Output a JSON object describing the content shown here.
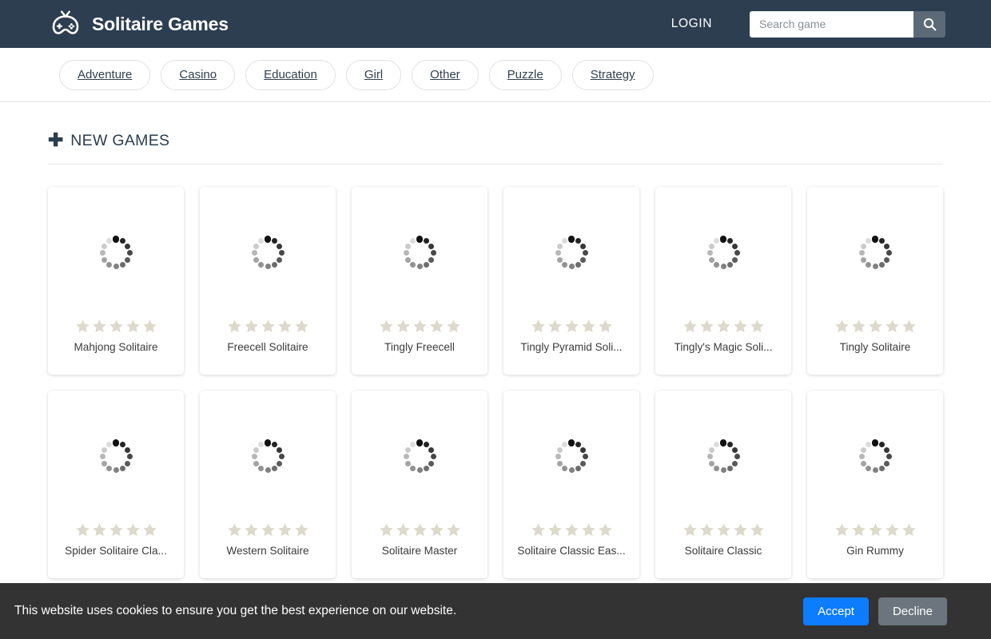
{
  "header": {
    "brand_name": "Solitaire Games",
    "brand_icon": "gamepad-icon",
    "login_label": "LOGIN",
    "search": {
      "placeholder": "Search game",
      "value": "",
      "button_icon": "search-icon"
    },
    "background_color": "#2c3e50"
  },
  "categories": [
    {
      "label": "Adventure"
    },
    {
      "label": "Casino"
    },
    {
      "label": "Education"
    },
    {
      "label": "Girl"
    },
    {
      "label": "Other"
    },
    {
      "label": "Puzzle"
    },
    {
      "label": "Strategy"
    }
  ],
  "section": {
    "plus_icon": "plus-icon",
    "title": "NEW GAMES"
  },
  "games": [
    {
      "title": "Mahjong Solitaire",
      "rating": 0,
      "max_rating": 5,
      "thumb_state": "loading"
    },
    {
      "title": "Freecell Solitaire",
      "rating": 0,
      "max_rating": 5,
      "thumb_state": "loading"
    },
    {
      "title": "Tingly Freecell",
      "rating": 0,
      "max_rating": 5,
      "thumb_state": "loading"
    },
    {
      "title": "Tingly Pyramid Soli...",
      "rating": 0,
      "max_rating": 5,
      "thumb_state": "loading"
    },
    {
      "title": "Tingly's Magic Soli...",
      "rating": 0,
      "max_rating": 5,
      "thumb_state": "loading"
    },
    {
      "title": "Tingly Solitaire",
      "rating": 0,
      "max_rating": 5,
      "thumb_state": "loading"
    },
    {
      "title": "Spider Solitaire Cla...",
      "rating": 0,
      "max_rating": 5,
      "thumb_state": "loading"
    },
    {
      "title": "Western Solitaire",
      "rating": 0,
      "max_rating": 5,
      "thumb_state": "loading"
    },
    {
      "title": "Solitaire Master",
      "rating": 0,
      "max_rating": 5,
      "thumb_state": "loading"
    },
    {
      "title": "Solitaire Classic Eas...",
      "rating": 0,
      "max_rating": 5,
      "thumb_state": "loading"
    },
    {
      "title": "Solitaire Classic",
      "rating": 0,
      "max_rating": 5,
      "thumb_state": "loading"
    },
    {
      "title": "Gin Rummy",
      "rating": 0,
      "max_rating": 5,
      "thumb_state": "loading"
    }
  ],
  "cookie_banner": {
    "message": "This website uses cookies to ensure you get the best experience on our website.",
    "accept_label": "Accept",
    "decline_label": "Decline",
    "accept_color": "#0d7cff",
    "decline_color": "#6c757d",
    "background_color": "#333333"
  }
}
